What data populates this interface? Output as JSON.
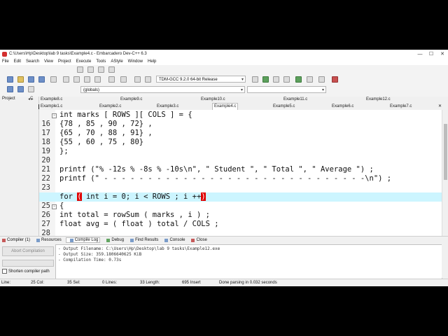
{
  "window": {
    "title": "C:\\Users\\Hp\\Desktop\\lab 9 tasks\\Example4.c - Embarcadero Dev-C++ 6.3",
    "controls": [
      "—",
      "☐",
      "✕"
    ]
  },
  "menu": [
    "File",
    "Edit",
    "Search",
    "View",
    "Project",
    "Execute",
    "Tools",
    "AStyle",
    "Window",
    "Help"
  ],
  "toolbar": {
    "compiler_select": "TDM-GCC 9.2.0 64-bit Release",
    "scope_select": "(globals)"
  },
  "project_tab": {
    "label": "Project",
    "class_label": "C"
  },
  "file_tabs_top": [
    "Example8.c",
    "Example9.c",
    "Example10.c",
    "Example11.c",
    "Example12.c"
  ],
  "file_tabs_bottom": [
    "Example1.c",
    "Example2.c",
    "Example3.c",
    "Example4.c",
    "Example5.c",
    "Example6.c",
    "Example7.c"
  ],
  "active_tab": "Example4.c",
  "code_lines": [
    {
      "num": "16",
      "fold": "−",
      "text": "int marks [ ROWS ][ COLS ] = {"
    },
    {
      "num": "17",
      "fold": "",
      "text": "{78 , 85 , 90 , 72} ,"
    },
    {
      "num": "18",
      "fold": "",
      "text": "{65 , 70 , 88 , 91} ,"
    },
    {
      "num": "19",
      "fold": "",
      "text": "{55 , 60 , 75 , 80}"
    },
    {
      "num": "20",
      "fold": "",
      "text": "};"
    },
    {
      "num": "21",
      "fold": "",
      "text": ""
    },
    {
      "num": "22",
      "fold": "",
      "text": "printf (\"% -12s % -8s % -10s\\n\", \" Student \", \" Total \", \" Average \") ;"
    },
    {
      "num": "23",
      "fold": "",
      "text": "printf (\" - - - - - - - - - - - - - - - - - - - - - - - - - - - - - -\\n\") ;"
    },
    {
      "num": "24",
      "fold": "",
      "text": ""
    },
    {
      "num": "25",
      "fold": "",
      "text": "for ( int i = 0; i < ROWS ; i ++)"
    },
    {
      "num": "26",
      "fold": "−",
      "text": "{"
    },
    {
      "num": "27",
      "fold": "",
      "text": "int total = rowSum ( marks , i ) ;"
    },
    {
      "num": "28",
      "fold": "",
      "text": "float avg = ( float ) total / COLS ;"
    }
  ],
  "bottom_tabs": [
    "Compiler (1)",
    "Resources",
    "Compile Log",
    "Debug",
    "Find Results",
    "Console",
    "Close"
  ],
  "compile_panel": {
    "abort_label": "Abort Compilation",
    "shorten_label": "Shorten compiler path",
    "log": [
      "- Output Filename: C:\\Users\\Hp\\Desktop\\lab 9 tasks\\Example12.exe",
      "- Output Size: 359.1806640625 KiB",
      "- Compilation Time: 0.73s"
    ]
  },
  "status": {
    "line": "Line:",
    "line_val": "25 Col:",
    "col_val": "35 Sel:",
    "sel_val": "0 Lines:",
    "lines_val": "33 Length:",
    "length_val": "695 Insert",
    "msg": "Done parsing in 0.032 seconds"
  }
}
